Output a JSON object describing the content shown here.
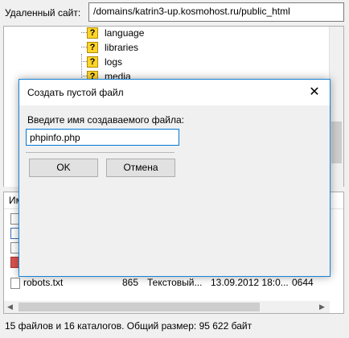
{
  "address_bar": {
    "label": "Удаленный сайт:",
    "path": "/domains/katrin3-up.kosmohost.ru/public_html"
  },
  "tree": {
    "items": [
      "language",
      "libraries",
      "logs",
      "media"
    ]
  },
  "file_list": {
    "header_first_col_fragment": "Им",
    "rows": [
      {
        "name": "robots.txt",
        "size": "865",
        "type": "Текстовый...",
        "modified": "13.09.2012 18:0...",
        "permissions": "0644"
      }
    ]
  },
  "status_bar": {
    "text": "15 файлов и 16 каталогов. Общий размер: 95 622 байт"
  },
  "dialog": {
    "title": "Создать пустой файл",
    "prompt": "Введите имя создаваемого файла:",
    "input_value": "phpinfo.php",
    "ok_label": "OK",
    "cancel_label": "Отмена"
  }
}
